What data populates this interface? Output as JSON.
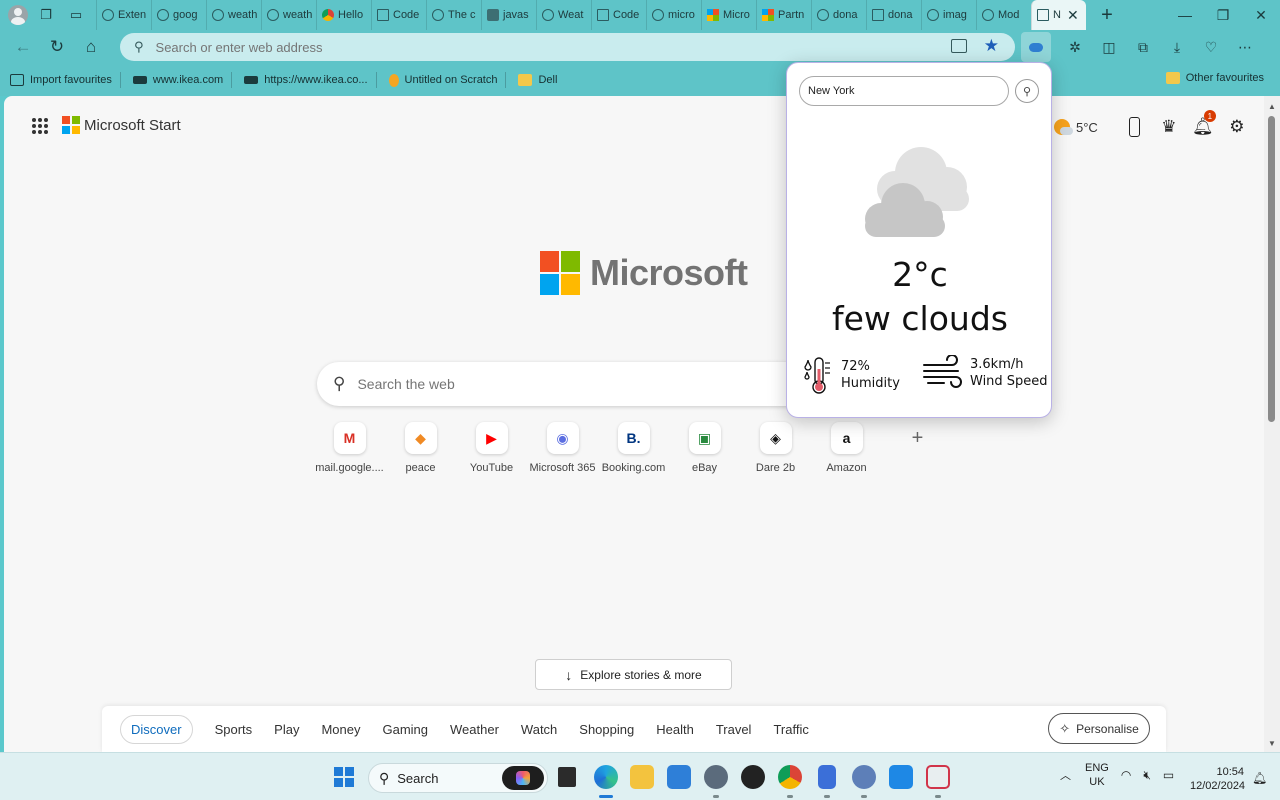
{
  "browser": {
    "tabs": [
      {
        "label": "Exten",
        "icon": "extension-icon"
      },
      {
        "label": "goog",
        "icon": "search-icon"
      },
      {
        "label": "weath",
        "icon": "search-icon"
      },
      {
        "label": "weath",
        "icon": "search-icon"
      },
      {
        "label": "Hello",
        "icon": "chrome-icon"
      },
      {
        "label": "Code",
        "icon": "doc-icon"
      },
      {
        "label": "The c",
        "icon": "search-icon"
      },
      {
        "label": "javas",
        "icon": "javascript-icon"
      },
      {
        "label": "Weat",
        "icon": "weather-icon"
      },
      {
        "label": "Code",
        "icon": "doc-icon"
      },
      {
        "label": "micro",
        "icon": "search-icon"
      },
      {
        "label": "Micro",
        "icon": "microsoft-icon"
      },
      {
        "label": "Partn",
        "icon": "microsoft-icon"
      },
      {
        "label": "dona",
        "icon": "search-icon"
      },
      {
        "label": "dona",
        "icon": "doc-icon"
      },
      {
        "label": "imag",
        "icon": "search-icon"
      },
      {
        "label": "Mod",
        "icon": "search-icon"
      }
    ],
    "active_tab": {
      "label": "N",
      "icon": "newtab-icon"
    },
    "address": {
      "placeholder": "Search or enter web address",
      "value": ""
    },
    "favourites": [
      {
        "label": "Import favourites",
        "icon": "import-icon"
      },
      {
        "label": "www.ikea.com",
        "icon": "ikea-icon"
      },
      {
        "label": "https://www.ikea.co...",
        "icon": "ikea-icon"
      },
      {
        "label": "Untitled on Scratch",
        "icon": "scratch-icon"
      },
      {
        "label": "Dell",
        "icon": "folder-icon"
      }
    ],
    "other_favourites": "Other favourites"
  },
  "newtab": {
    "brand": "Microsoft Start",
    "logo_text": "Microsoft",
    "weather_chip": "5°C",
    "notifications_count": "1",
    "search_placeholder": "Search the web",
    "quick_links": [
      {
        "label": "mail.google....",
        "glyph": "M",
        "color": "#d93025"
      },
      {
        "label": "peace",
        "glyph": "◆",
        "color": "#f08a24"
      },
      {
        "label": "YouTube",
        "glyph": "▶",
        "color": "#ff0000"
      },
      {
        "label": "Microsoft 365",
        "glyph": "◉",
        "color": "#5b6ee1"
      },
      {
        "label": "Booking.com",
        "glyph": "B.",
        "color": "#003580"
      },
      {
        "label": "eBay",
        "glyph": "▣",
        "color": "#2a8a3f"
      },
      {
        "label": "Dare 2b",
        "glyph": "◈",
        "color": "#111111"
      },
      {
        "label": "Amazon",
        "glyph": "a",
        "color": "#111111"
      }
    ],
    "explore_label": "Explore stories & more",
    "feed_tabs": [
      "Discover",
      "Sports",
      "Play",
      "Money",
      "Gaming",
      "Weather",
      "Watch",
      "Shopping",
      "Health",
      "Travel",
      "Traffic"
    ],
    "personalise_label": "Personalise"
  },
  "weather_popup": {
    "city": "New York",
    "temperature": "2°c",
    "condition": "few clouds",
    "humidity_value": "72%",
    "humidity_label": "Humidity",
    "wind_value": "3.6km/h",
    "wind_label": "Wind Speed"
  },
  "taskbar": {
    "search_label": "Search",
    "language_line1": "ENG",
    "language_line2": "UK",
    "time": "10:54",
    "date": "12/02/2024"
  },
  "colors": {
    "chrome_teal": "#5ec4c8",
    "accent_blue": "#0f6cbd",
    "ms_red": "#f25022",
    "ms_green": "#7fba00",
    "ms_blue": "#00a4ef",
    "ms_yellow": "#ffb900"
  }
}
